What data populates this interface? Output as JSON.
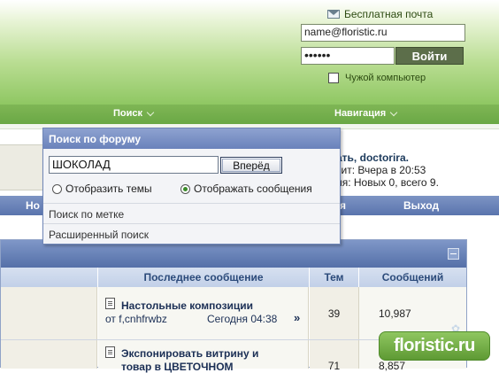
{
  "header": {
    "mail_link": "Бесплатная почта",
    "login_value": "name@floristic.ru",
    "password_mask": "••••••",
    "login_button": "Войти",
    "remember_label": "Чужой компьютер"
  },
  "navbar": {
    "search": "Поиск",
    "navigation": "Навигация"
  },
  "welcome": {
    "line1_prefix": "ать, ",
    "user": "doctorira.",
    "line2": "зит: Вчера в 20:53",
    "line3": "ия: Новых 0, всего 9."
  },
  "bluebar": {
    "left": "Но",
    "mid": "я",
    "right": "Выход"
  },
  "search_popup": {
    "title": "Поиск по форуму",
    "query": "ШОКОЛАД",
    "go_button": "Вперёд",
    "option_topics": "Отобразить темы",
    "option_posts": "Отображать сообщения",
    "by_tag": "Поиск по метке",
    "advanced": "Расширенный поиск"
  },
  "forum_table": {
    "columns": [
      "Последнее сообщение",
      "Тем",
      "Сообщений"
    ],
    "rows": [
      {
        "title": "Настольные композиции",
        "author": "от f,cnhfrwbz",
        "date": "Сегодня 04:38",
        "topics": "39",
        "posts": "10,987"
      },
      {
        "title": "Экспонировать витрину и",
        "title2": "товар в ЦВЕТОЧНОМ",
        "topics": "71",
        "posts": "8,857"
      }
    ]
  },
  "logo": {
    "text": "floristic.ru"
  },
  "colors": {
    "header_green": "#8fc763",
    "nav_green": "#6aa845",
    "blue": "#5a74ad"
  }
}
